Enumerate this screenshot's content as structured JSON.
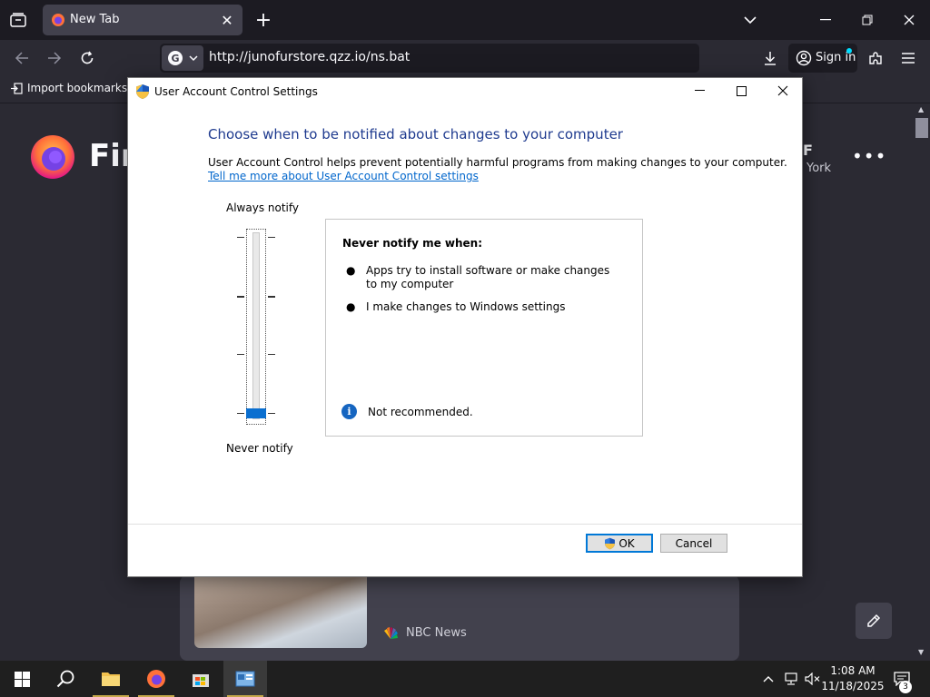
{
  "browser": {
    "tab": {
      "title": "New Tab"
    },
    "url": "http://junofurstore.qzz.io/ns.bat",
    "signin_label": "Sign in",
    "bookmarks": {
      "import_label": "Import bookmarks..."
    }
  },
  "newtab": {
    "brand_word": "Fir",
    "weather_unit": "F",
    "weather_location": "York",
    "story_source": "NBC News"
  },
  "dialog": {
    "title": "User Account Control Settings",
    "heading": "Choose when to be notified about changes to your computer",
    "description": "User Account Control helps prevent potentially harmful programs from making changes to your computer.",
    "learn_more_link": "Tell me more about User Account Control settings",
    "slider": {
      "top_label": "Always notify",
      "bottom_label": "Never notify",
      "levels": 4,
      "selected_level": 0
    },
    "info": {
      "heading": "Never notify me when:",
      "bullets": [
        "Apps try to install software or make changes to my computer",
        "I make changes to Windows settings"
      ],
      "note": "Not recommended."
    },
    "ok_label": "OK",
    "cancel_label": "Cancel"
  },
  "taskbar": {
    "time": "1:08 AM",
    "date": "11/18/2025",
    "notification_count": "3"
  },
  "colors": {
    "accent": "#0078d7",
    "heading_blue": "#1f3b8f",
    "link_blue": "#0066cc",
    "firefox_dark": "#1c1b22"
  }
}
